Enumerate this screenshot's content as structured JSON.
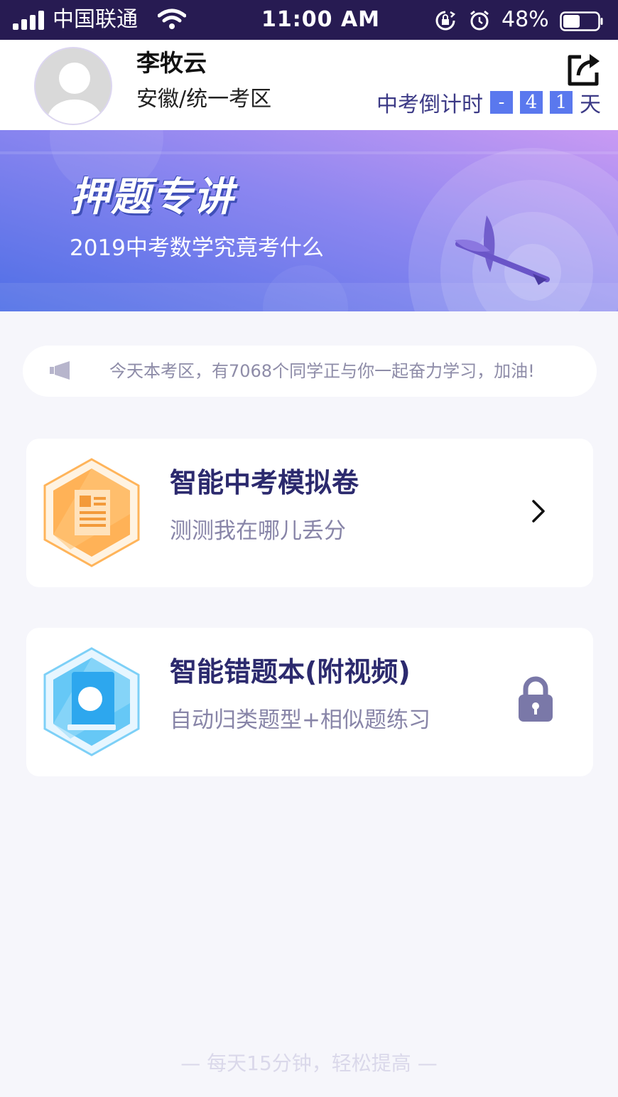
{
  "status_bar": {
    "carrier": "中国联通",
    "time": "11:00 AM",
    "battery_percent": "48%",
    "battery_level": 0.48,
    "icons": [
      "signal-icon",
      "wifi-icon",
      "rotation-lock-icon",
      "alarm-icon",
      "battery-icon"
    ]
  },
  "profile": {
    "name": "李牧云",
    "region": "安徽/统一考区",
    "avatar_icon": "default-avatar-icon"
  },
  "share_icon": "share-icon",
  "countdown": {
    "label": "中考倒计时",
    "digits": [
      "-",
      "4",
      "1"
    ],
    "unit": "天"
  },
  "banner": {
    "title": "押题专讲",
    "subtitle": "2019中考数学究竟考什么",
    "illustration": "dart-target"
  },
  "notice": {
    "icon": "megaphone-icon",
    "text": "今天本考区，有7068个同学正与你一起奋力学习，加油!"
  },
  "cards": [
    {
      "title": "智能中考模拟卷",
      "desc": "测测我在哪儿丢分",
      "icon": "exam-paper-icon",
      "action_icon": "chevron-right-icon"
    },
    {
      "title": "智能错题本(附视频)",
      "desc": "自动归类题型+相似题练习",
      "icon": "notebook-icon",
      "action_icon": "lock-icon"
    }
  ],
  "footer": {
    "slogan": "—  每天15分钟，轻松提高  —"
  },
  "colors": {
    "status_bar": "#271b52",
    "accent_blue": "#5a78ee",
    "title_text": "#2c2a6e",
    "muted_text": "#8885a8",
    "page_bg": "#f6f6fb"
  }
}
